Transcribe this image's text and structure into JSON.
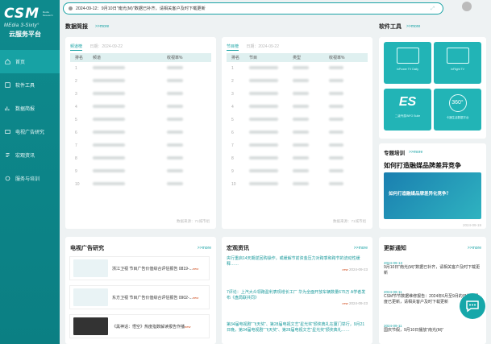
{
  "brand": {
    "logo": "CSM",
    "logo_side": "Media Research",
    "subtitle": "MEdia 3-Sixty°",
    "platform": "云服务平台"
  },
  "nav": [
    {
      "label": "首页",
      "icon": "home-icon"
    },
    {
      "label": "软件工具",
      "icon": "tool-icon"
    },
    {
      "label": "数据简报",
      "icon": "chart-icon"
    },
    {
      "label": "电视广告研究",
      "icon": "tv-icon"
    },
    {
      "label": "宏观资讯",
      "icon": "news-icon"
    },
    {
      "label": "服务与培训",
      "icon": "service-icon"
    }
  ],
  "search": {
    "text": "2024-09-12：9月10日\"南光(M)\"数据已补齐，请相关客户及时下载更新"
  },
  "sections": {
    "brief": "数据简报",
    "tools": "软件工具",
    "training": "专题培训",
    "tv_ads": "电视广告研究",
    "macro": "宏观资讯",
    "updates": "更新通知",
    "more": ">>more"
  },
  "brief_left": {
    "tab": "频道榜",
    "date": "日期：2024-09-22",
    "columns": [
      "排名",
      "频道",
      "收视率%"
    ],
    "ranks": [
      "1",
      "2",
      "3",
      "4",
      "5",
      "6",
      "7",
      "8",
      "9",
      "10"
    ],
    "footer": "数据来源：71城市组"
  },
  "brief_right": {
    "tab": "节目榜",
    "date": "日期：2024-09-22",
    "columns": [
      "排名",
      "节目",
      "类型",
      "收视率%"
    ],
    "ranks": [
      "1",
      "2",
      "3",
      "4",
      "5",
      "6",
      "7",
      "8",
      "9",
      "10"
    ],
    "footer": "数据来源：71城市组"
  },
  "tools": [
    {
      "label": "InPower TV Daily"
    },
    {
      "label": "InFlight TV"
    },
    {
      "label": "二级专属INFO Suite"
    },
    {
      "label": "卡通生活数据平台"
    }
  ],
  "training": {
    "title": "如何打造融媒品牌差异竞争",
    "banner": "如何打造融媒品牌差异化竞争？",
    "date": "2024-09-19"
  },
  "tv_ads": [
    {
      "text": "浙江卫视 节目广告价值综合评估报告 0819-...",
      "tag": "new"
    },
    {
      "text": "东方卫视 节目广告价值综合评估报告 0902-...",
      "tag": "new"
    },
    {
      "text": "《黑神话：悟空》热度指数解读报告作播",
      "tag": "new"
    }
  ],
  "macro": [
    {
      "text": "央行重启14天期逆回购操作，或缓解节前资金压力对跨季和跨节的流动性缓释……",
      "date": "2024-09-23",
      "tag": "new"
    },
    {
      "text": "7评论：上汽大众领跑盈利表现增长工厂 华为全面开放车辆数量675万 A学者发布《盘局联共同》",
      "date": "2024-09-23",
      "tag": "new"
    },
    {
      "text": "第34届电视剧“飞天奖”、第28届电视文艺“星光奖”颁奖典礼在厦门举行，9月21日晚，第34届电视剧“飞天奖”、第28届电视文艺“星光奖”颁奖典礼……",
      "date": "",
      "tag": ""
    }
  ],
  "updates": [
    {
      "date": "2024-09-13",
      "text": "9月10日“南光(M)”数据已补齐，请相关客户及时下载更新"
    },
    {
      "date": "2024-09-11",
      "text": "CSM节节数据维修报告：2024年6月至9月的日数据月度已更新，请相关客户及时下载更新"
    },
    {
      "date": "2024-09-11",
      "text": "国庆节假，9月10日播放“南光(M)”"
    }
  ]
}
